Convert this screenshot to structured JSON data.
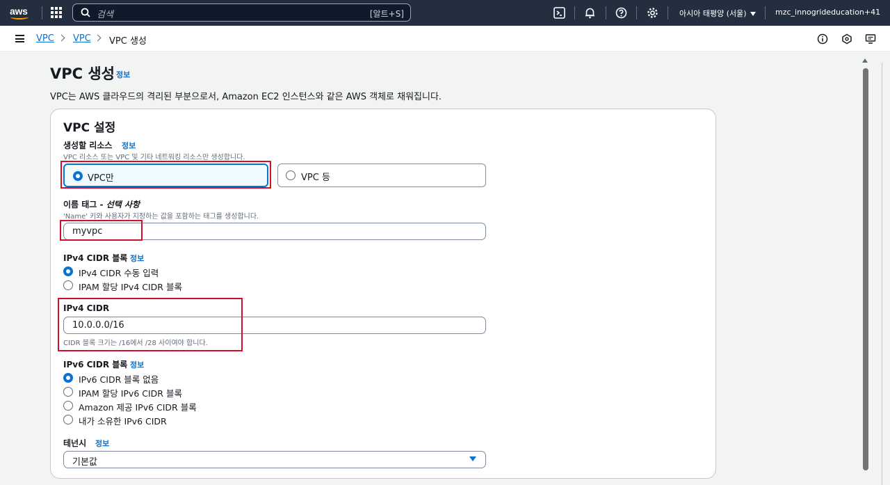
{
  "topnav": {
    "logo_text": "aws",
    "search_placeholder": "검색",
    "search_shortcut": "[알트+S]",
    "region": "아시아 태평양 (서울)",
    "account": "mzc_innogrideducation+41",
    "icons": [
      "apps-grid-icon",
      "search-icon",
      "cloudshell-icon",
      "bell-icon",
      "help-icon",
      "gear-icon"
    ]
  },
  "breadcrumb": {
    "items": [
      {
        "label": "VPC",
        "link": true
      },
      {
        "label": "VPC",
        "link": true
      },
      {
        "label": "VPC 생성",
        "link": false
      }
    ]
  },
  "page": {
    "title": "VPC 생성",
    "title_info": "정보",
    "description": "VPC는 AWS 클라우드의 격리된 부분으로서, Amazon EC2 인스턴스와 같은 AWS 객체로 채워집니다."
  },
  "vpc_settings": {
    "heading": "VPC 설정",
    "resources": {
      "label": "생성할 리소스",
      "info": "정보",
      "hint": "VPC 리소스 또는 VPC 및 기타 네트워킹 리소스만 생성합니다.",
      "options": [
        "VPC만",
        "VPC 등"
      ],
      "selected": "VPC만"
    },
    "name_tag": {
      "label": "이름 태그 - ",
      "label_optional": "선택 사항",
      "hint": "'Name' 키와 사용자가 지정하는 값을 포함하는 태그를 생성합니다.",
      "value": "myvpc"
    },
    "ipv4_block": {
      "label": "IPv4 CIDR 블록",
      "info": "정보",
      "options": [
        "IPv4 CIDR 수동 입력",
        "IPAM 할당 IPv4 CIDR 블록"
      ],
      "selected": "IPv4 CIDR 수동 입력"
    },
    "ipv4_cidr": {
      "label": "IPv4 CIDR",
      "value": "10.0.0.0/16",
      "hint": "CIDR 블록 크기는 /16에서 /28 사이여야 합니다."
    },
    "ipv6_block": {
      "label": "IPv6 CIDR 블록",
      "info": "정보",
      "options": [
        "IPv6 CIDR 블록 없음",
        "IPAM 할당 IPv6 CIDR 블록",
        "Amazon 제공 IPv6 CIDR 블록",
        "내가 소유한 IPv6 CIDR"
      ],
      "selected": "IPv6 CIDR 블록 없음"
    },
    "tenancy": {
      "label": "테넌시",
      "info": "정보",
      "value": "기본값"
    }
  },
  "colors": {
    "nav_bg": "#232f3e",
    "link": "#0972d3",
    "highlight": "#d3102a",
    "aws_orange": "#ff9900"
  }
}
